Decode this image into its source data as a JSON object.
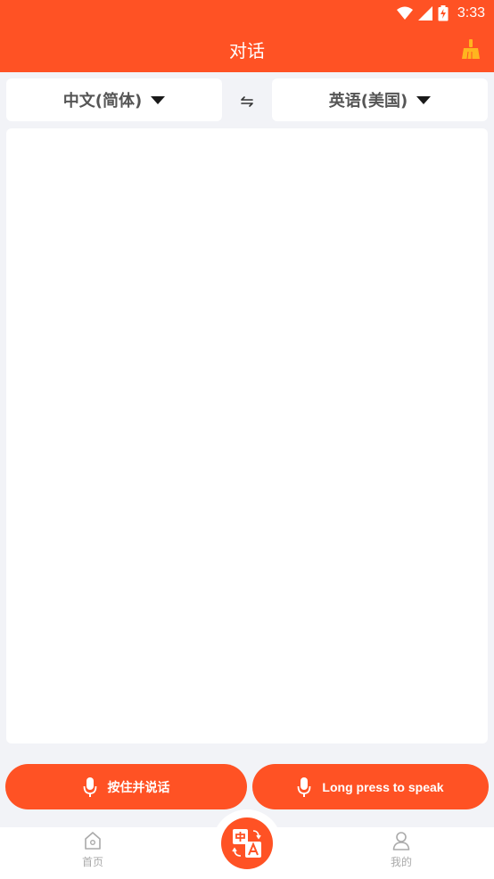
{
  "status_bar": {
    "time": "3:33"
  },
  "app_bar": {
    "title": "对话"
  },
  "languages": {
    "source": "中文(简体)",
    "target": "英语(美国)"
  },
  "speak_buttons": {
    "source_label": "按住并说话",
    "target_label": "Long press to speak"
  },
  "tab_bar": {
    "home_label": "首页",
    "mine_label": "我的"
  },
  "colors": {
    "accent": "#ff5224",
    "background": "#f2f3f7",
    "card": "#ffffff",
    "broom": "#ffb51f"
  }
}
